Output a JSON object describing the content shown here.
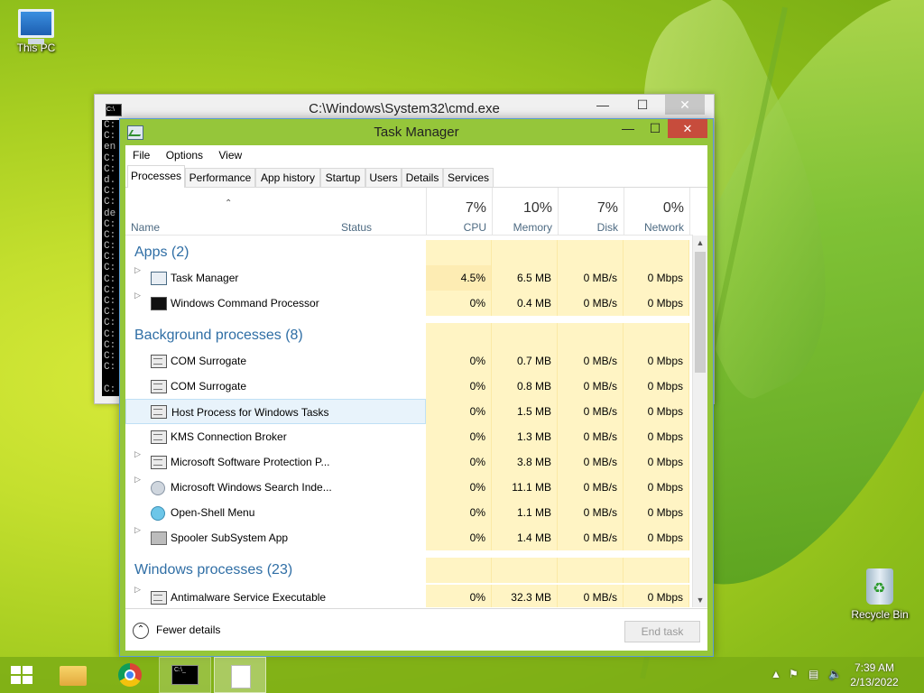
{
  "desktop": {
    "icons": [
      {
        "label": "This PC"
      },
      {
        "label": "Recycle Bin"
      }
    ]
  },
  "cmd_window": {
    "title": "C:\\Windows\\System32\\cmd.exe",
    "console_lines": [
      "C:",
      "C:",
      "en",
      "C:",
      "C:",
      "d.",
      "C:",
      "C:",
      "de",
      "C:",
      "C:",
      "C:",
      "C:",
      "C:",
      "C:",
      "C:",
      "C:",
      "C:",
      "C:",
      "C:",
      "C:",
      "C:",
      "C:",
      "",
      "C:"
    ]
  },
  "task_manager": {
    "title": "Task Manager",
    "menu": [
      "File",
      "Options",
      "View"
    ],
    "tabs": [
      "Processes",
      "Performance",
      "App history",
      "Startup",
      "Users",
      "Details",
      "Services"
    ],
    "active_tab": "Processes",
    "columns": {
      "name": "Name",
      "status": "Status",
      "cpu": {
        "pct": "7%",
        "label": "CPU"
      },
      "memory": {
        "pct": "10%",
        "label": "Memory"
      },
      "disk": {
        "pct": "7%",
        "label": "Disk"
      },
      "network": {
        "pct": "0%",
        "label": "Network"
      }
    },
    "groups": {
      "apps": "Apps (2)",
      "background": "Background processes (8)",
      "windows": "Windows processes (23)"
    },
    "apps": [
      {
        "name": "Task Manager",
        "cpu": "4.5%",
        "mem": "6.5 MB",
        "disk": "0 MB/s",
        "net": "0 Mbps",
        "icon": "task-manager-icon"
      },
      {
        "name": "Windows Command Processor",
        "cpu": "0%",
        "mem": "0.4 MB",
        "disk": "0 MB/s",
        "net": "0 Mbps",
        "icon": "cmd-icon"
      }
    ],
    "background": [
      {
        "name": "COM Surrogate",
        "cpu": "0%",
        "mem": "0.7 MB",
        "disk": "0 MB/s",
        "net": "0 Mbps",
        "icon": "service-icon"
      },
      {
        "name": "COM Surrogate",
        "cpu": "0%",
        "mem": "0.8 MB",
        "disk": "0 MB/s",
        "net": "0 Mbps",
        "icon": "service-icon"
      },
      {
        "name": "Host Process for Windows Tasks",
        "cpu": "0%",
        "mem": "1.5 MB",
        "disk": "0 MB/s",
        "net": "0 Mbps",
        "icon": "service-icon"
      },
      {
        "name": "KMS Connection Broker",
        "cpu": "0%",
        "mem": "1.3 MB",
        "disk": "0 MB/s",
        "net": "0 Mbps",
        "icon": "service-icon"
      },
      {
        "name": "Microsoft Software Protection P...",
        "cpu": "0%",
        "mem": "3.8 MB",
        "disk": "0 MB/s",
        "net": "0 Mbps",
        "icon": "service-icon"
      },
      {
        "name": "Microsoft Windows Search Inde...",
        "cpu": "0%",
        "mem": "11.1 MB",
        "disk": "0 MB/s",
        "net": "0 Mbps",
        "icon": "search-indexer-icon"
      },
      {
        "name": "Open-Shell Menu",
        "cpu": "0%",
        "mem": "1.1 MB",
        "disk": "0 MB/s",
        "net": "0 Mbps",
        "icon": "shell-icon"
      },
      {
        "name": "Spooler SubSystem App",
        "cpu": "0%",
        "mem": "1.4 MB",
        "disk": "0 MB/s",
        "net": "0 Mbps",
        "icon": "printer-icon"
      }
    ],
    "windows_first": {
      "name": "Antimalware Service Executable",
      "cpu": "0%",
      "mem": "32.3 MB",
      "disk": "0 MB/s",
      "net": "0 Mbps"
    },
    "fewer_details": "Fewer details",
    "end_task": "End task"
  },
  "taskbar": {
    "clock_time": "7:39 AM",
    "clock_date": "2/13/2022"
  }
}
